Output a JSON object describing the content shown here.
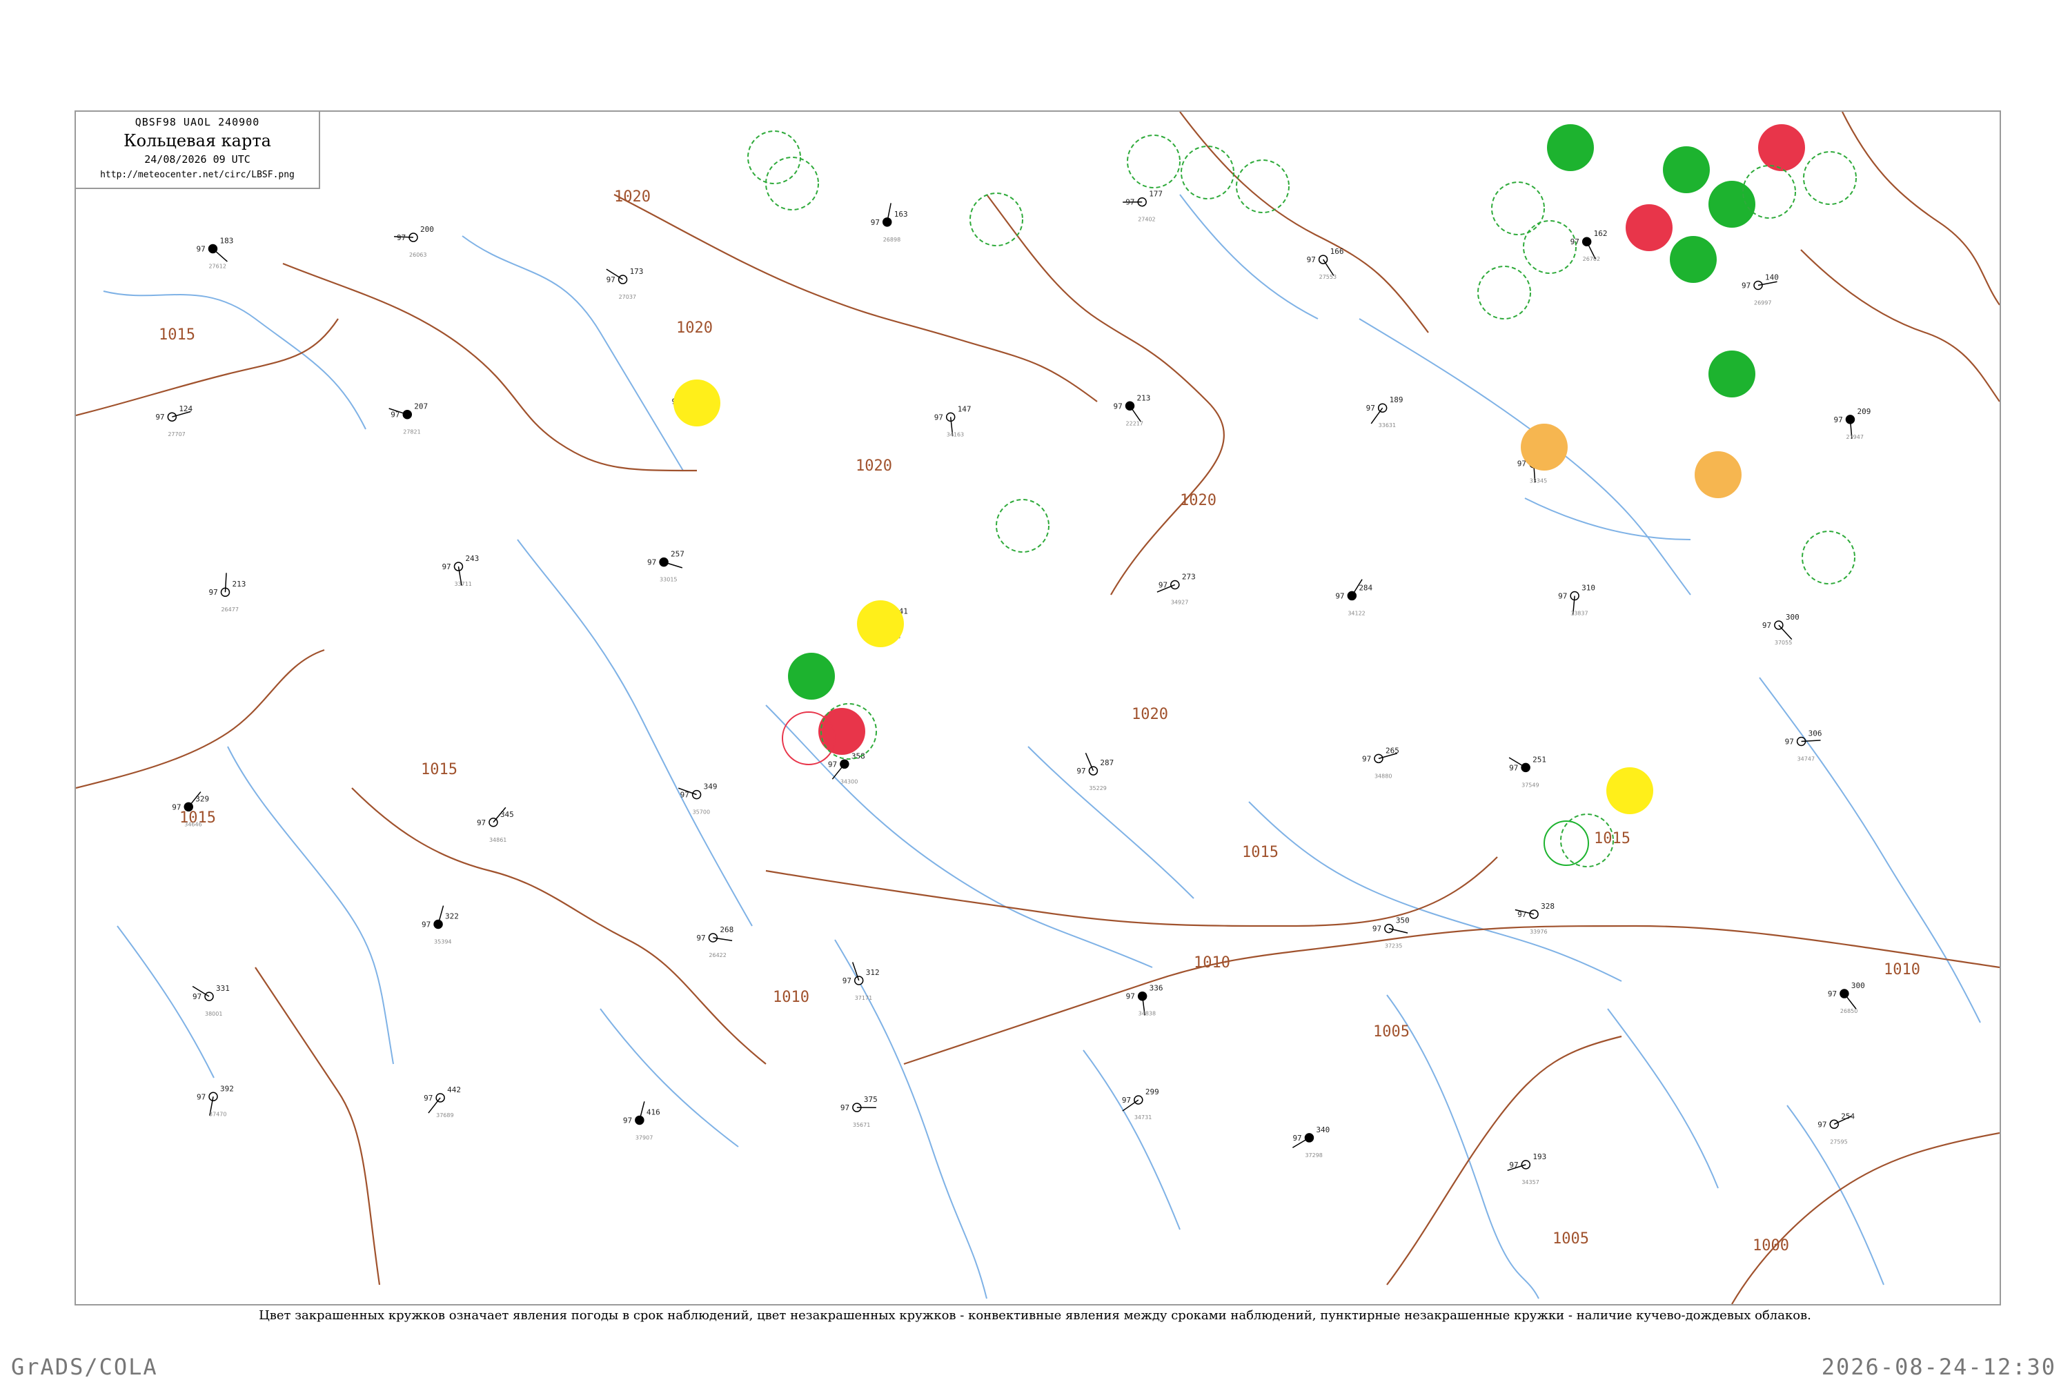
{
  "header": {
    "code": "QBSF98  UAOL  240900",
    "title": "Кольцевая карта",
    "time": "24/08/2026 09 UTC",
    "url": "http://meteocenter.net/circ/LBSF.png"
  },
  "caption": "Цвет закрашенных кружков означает явления погоды в срок наблюдений, цвет незакрашенных кружков - конвективные явления между сроками наблюдений, пунктирные незакрашенные кружки - наличие кучево-дождевых облаков.",
  "footer": {
    "left": "GrADS/COLA",
    "right": "2026-08-24-12:30"
  },
  "colors": {
    "isobar": "#a0522d",
    "river": "#7fb2e6",
    "frame": "#9a9a9a",
    "green": "#1db32f",
    "red": "#e8354a",
    "yellow": "#ffef1a",
    "orange": "#f6b650",
    "cb_ring": "#2eaa3a"
  },
  "isobar_labels": [
    "1015",
    "1020",
    "1020",
    "1020",
    "1020",
    "1020",
    "1015",
    "1015",
    "1015",
    "1015",
    "1010",
    "1010",
    "1005",
    "1005",
    "1010",
    "1000"
  ],
  "stations": [
    {
      "p": "183",
      "t": "97",
      "id": "27612"
    },
    {
      "p": "200",
      "t": "97",
      "id": "26063"
    },
    {
      "p": "173",
      "t": "97",
      "id": "27037"
    },
    {
      "p": "163",
      "t": "97",
      "id": "26898"
    },
    {
      "p": "177",
      "t": "97",
      "id": "27402"
    },
    {
      "p": "166",
      "t": "97",
      "id": "27553"
    },
    {
      "p": "162",
      "t": "97",
      "id": "26702"
    },
    {
      "p": "140",
      "t": "97",
      "id": "26997"
    },
    {
      "p": "124",
      "t": "97",
      "id": "27707"
    },
    {
      "p": "207",
      "t": "97",
      "id": "27821"
    },
    {
      "p": "109",
      "t": "97",
      "id": "28722"
    },
    {
      "p": "147",
      "t": "97",
      "id": "34163"
    },
    {
      "p": "213",
      "t": "97",
      "id": "22217"
    },
    {
      "p": "189",
      "t": "97",
      "id": "33631"
    },
    {
      "p": "198",
      "t": "97",
      "id": "33345"
    },
    {
      "p": "209",
      "t": "97",
      "id": "27947"
    },
    {
      "p": "213",
      "t": "97",
      "id": "26477"
    },
    {
      "p": "243",
      "t": "97",
      "id": "33711"
    },
    {
      "p": "257",
      "t": "97",
      "id": "33015"
    },
    {
      "p": "241",
      "t": "97",
      "id": "34214"
    },
    {
      "p": "273",
      "t": "97",
      "id": "34927"
    },
    {
      "p": "284",
      "t": "97",
      "id": "34122"
    },
    {
      "p": "310",
      "t": "97",
      "id": "33837"
    },
    {
      "p": "300",
      "t": "97",
      "id": "37055"
    },
    {
      "p": "329",
      "t": "97",
      "id": "34646"
    },
    {
      "p": "345",
      "t": "97",
      "id": "34861"
    },
    {
      "p": "349",
      "t": "97",
      "id": "35700"
    },
    {
      "p": "358",
      "t": "97",
      "id": "34300"
    },
    {
      "p": "287",
      "t": "97",
      "id": "35229"
    },
    {
      "p": "265",
      "t": "97",
      "id": "34880"
    },
    {
      "p": "251",
      "t": "97",
      "id": "37549"
    },
    {
      "p": "306",
      "t": "97",
      "id": "34747"
    },
    {
      "p": "331",
      "t": "97",
      "id": "38001"
    },
    {
      "p": "322",
      "t": "97",
      "id": "35394"
    },
    {
      "p": "268",
      "t": "97",
      "id": "26422"
    },
    {
      "p": "312",
      "t": "97",
      "id": "37171"
    },
    {
      "p": "336",
      "t": "97",
      "id": "34838"
    },
    {
      "p": "350",
      "t": "97",
      "id": "37235"
    },
    {
      "p": "328",
      "t": "97",
      "id": "33976"
    },
    {
      "p": "300",
      "t": "97",
      "id": "26850"
    },
    {
      "p": "392",
      "t": "97",
      "id": "37470"
    },
    {
      "p": "442",
      "t": "97",
      "id": "37689"
    },
    {
      "p": "416",
      "t": "97",
      "id": "37907"
    },
    {
      "p": "375",
      "t": "97",
      "id": "35671"
    },
    {
      "p": "299",
      "t": "97",
      "id": "34731"
    },
    {
      "p": "340",
      "t": "97",
      "id": "37298"
    },
    {
      "p": "193",
      "t": "97",
      "id": "34357"
    },
    {
      "p": "254",
      "t": "97",
      "id": "27595"
    }
  ]
}
